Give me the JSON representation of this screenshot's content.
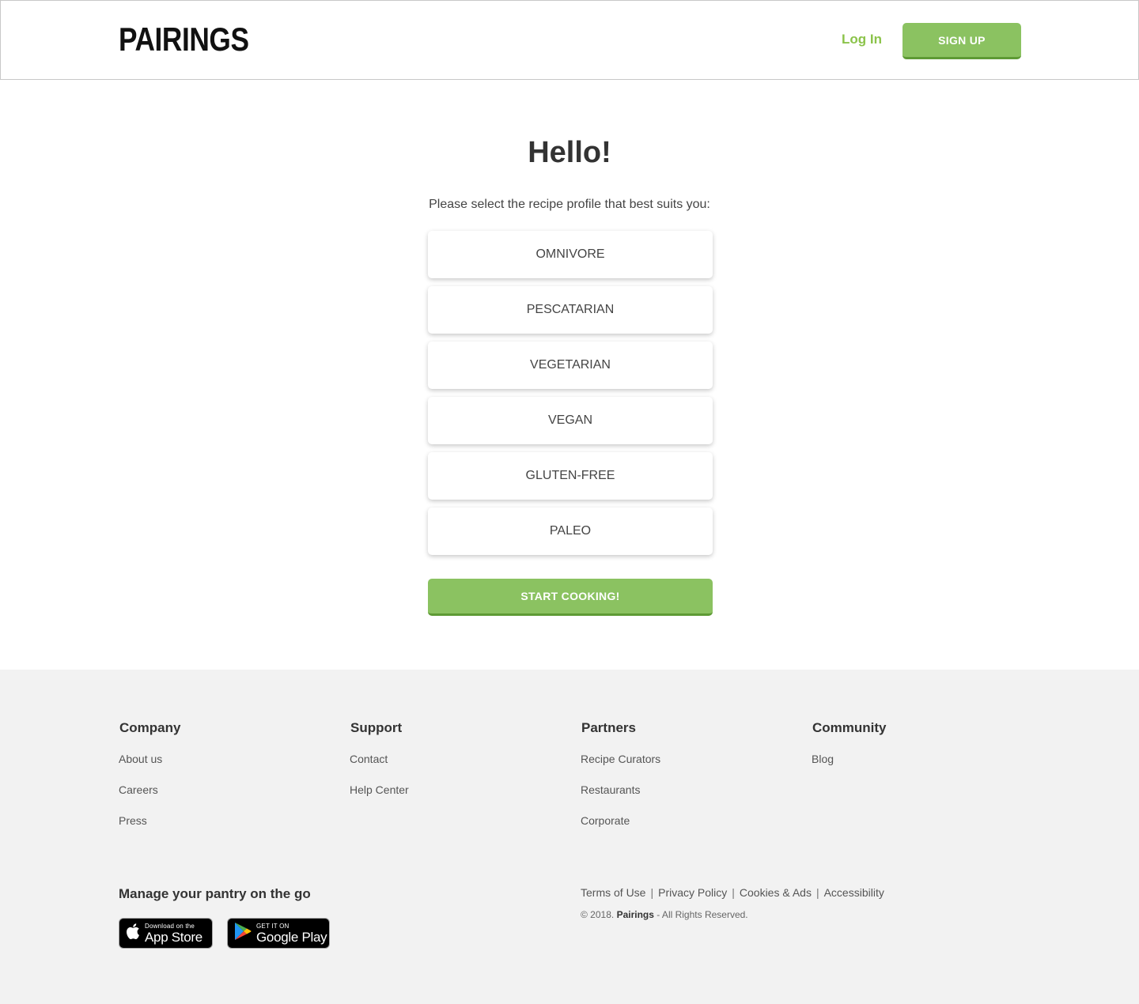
{
  "header": {
    "logo_text": "PAIRINGS",
    "login_label": "Log In",
    "signup_label": "SIGN UP"
  },
  "main": {
    "title": "Hello!",
    "subtitle": "Please select the recipe profile that best suits you:",
    "profiles": [
      "OMNIVORE",
      "PESCATARIAN",
      "VEGETARIAN",
      "VEGAN",
      "GLUTEN-FREE",
      "PALEO"
    ],
    "start_label": "START COOKING!"
  },
  "footer": {
    "columns": [
      {
        "heading": "Company",
        "links": [
          "About us",
          "Careers",
          "Press"
        ]
      },
      {
        "heading": "Support",
        "links": [
          "Contact",
          "Help Center"
        ]
      },
      {
        "heading": "Partners",
        "links": [
          "Recipe Curators",
          "Restaurants",
          "Corporate"
        ]
      },
      {
        "heading": "Community",
        "links": [
          "Blog"
        ]
      }
    ],
    "pantry_title": "Manage your pantry on the go",
    "app_store": {
      "small": "Download on the",
      "large": "App Store"
    },
    "google_play": {
      "small": "GET IT ON",
      "large": "Google Play"
    },
    "legal_links": [
      "Terms of Use",
      "Privacy Policy",
      "Cookies & Ads",
      "Accessibility"
    ],
    "separator": "|",
    "copyright_prefix": "© 2018.",
    "copyright_brand": "Pairings",
    "copyright_suffix": "- All Rights Reserved."
  },
  "colors": {
    "accent_green": "#8bc261",
    "accent_green_dark": "#5e9a35",
    "login_green": "#8bc34a",
    "footer_bg": "#f2f2f2"
  }
}
